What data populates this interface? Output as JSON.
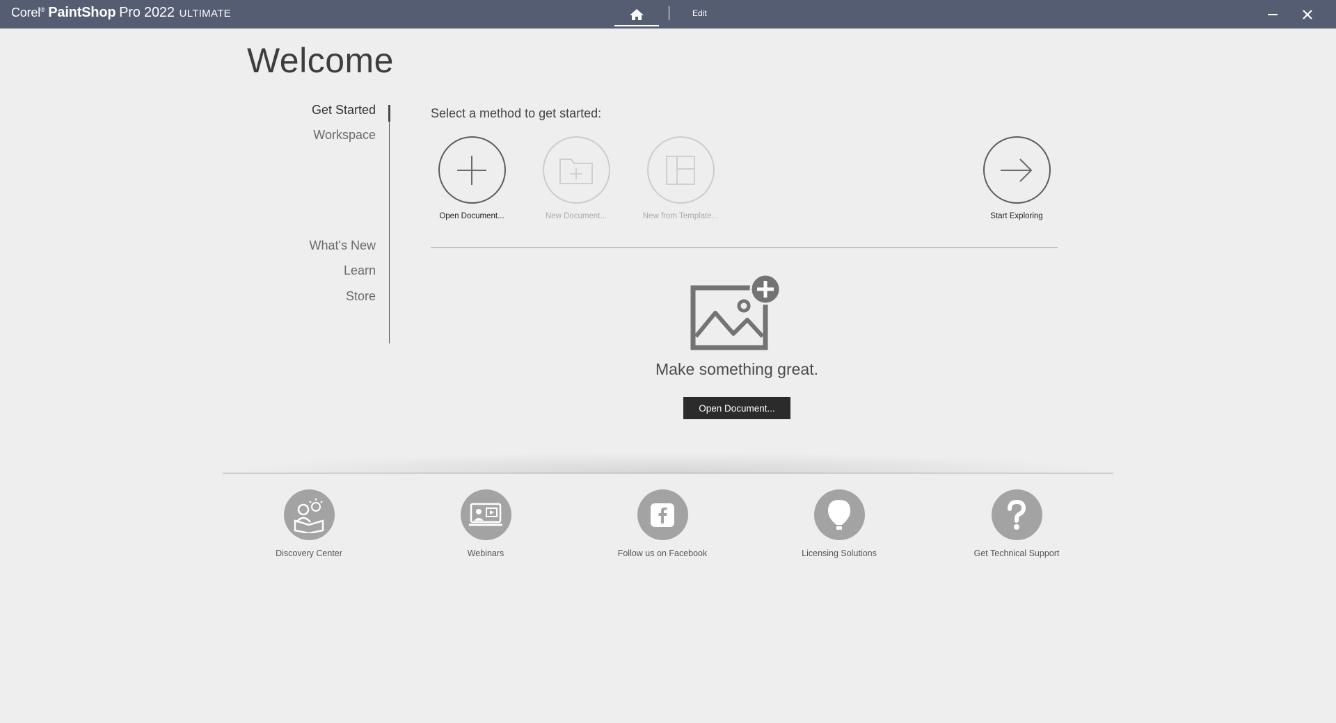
{
  "titlebar": {
    "brand_corel": "Corel",
    "brand_reg": "®",
    "brand_name": "PaintShop",
    "brand_pro": "Pro 2022",
    "brand_edition": "ULTIMATE",
    "edit_tab": "Edit",
    "home_icon": "home-icon",
    "minimize_icon": "minimize-icon",
    "close_icon": "close-icon"
  },
  "welcome": {
    "title": "Welcome"
  },
  "nav": {
    "items": [
      {
        "label": "Get Started",
        "active": true
      },
      {
        "label": "Workspace"
      },
      {
        "label": "What's New"
      },
      {
        "label": "Learn"
      },
      {
        "label": "Store"
      }
    ]
  },
  "get_started": {
    "prompt": "Select a method to get started:",
    "methods": [
      {
        "label": "Open Document...",
        "icon": "plus-icon",
        "enabled": true
      },
      {
        "label": "New Document...",
        "icon": "new-folder-icon",
        "enabled": false
      },
      {
        "label": "New from Template...",
        "icon": "template-icon",
        "enabled": false
      },
      {
        "label": "Start Exploring",
        "icon": "arrow-right-icon",
        "enabled": true
      }
    ],
    "hero_text": "Make something great.",
    "hero_button": "Open Document..."
  },
  "resources": [
    {
      "label": "Discovery Center",
      "icon": "discovery-center-icon"
    },
    {
      "label": "Webinars",
      "icon": "webinars-icon"
    },
    {
      "label": "Follow us on Facebook",
      "icon": "facebook-icon"
    },
    {
      "label": "Licensing Solutions",
      "icon": "licensing-icon"
    },
    {
      "label": "Get Technical Support",
      "icon": "help-icon"
    }
  ],
  "colors": {
    "titlebar_bg": "#555d73",
    "page_bg": "#eeeeee",
    "button_bg": "#2b2b2b",
    "resource_circle": "#a3a3a3"
  }
}
